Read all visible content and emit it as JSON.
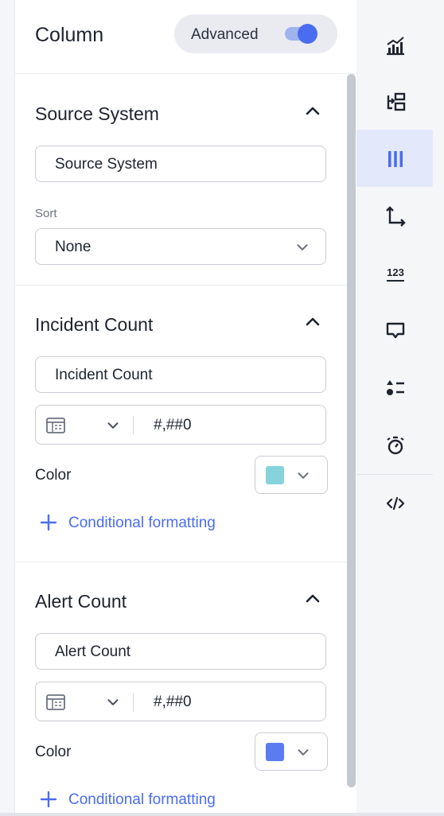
{
  "panel": {
    "title": "Column",
    "advanced_label": "Advanced",
    "advanced_on": true
  },
  "sections": [
    {
      "title": "Source System",
      "name_value": "Source System",
      "sort_label": "Sort",
      "sort_value": "None"
    },
    {
      "title": "Incident Count",
      "name_value": "Incident Count",
      "format_value": "#,##0",
      "color_label": "Color",
      "color": "#86d3dc",
      "conditional_label": "Conditional formatting"
    },
    {
      "title": "Alert Count",
      "name_value": "Alert Count",
      "format_value": "#,##0",
      "color_label": "Color",
      "color": "#5b7bf0",
      "conditional_label": "Conditional formatting"
    }
  ],
  "rail": {
    "items": [
      "chart-type-icon",
      "transform-icon",
      "column-icon",
      "axis-icon",
      "number-format-icon",
      "tooltip-icon",
      "legend-icon",
      "timer-icon",
      "code-icon"
    ],
    "active": "column-icon"
  },
  "colors": {
    "accent": "#4a6cf0",
    "active_bg": "#e3e8fb"
  }
}
